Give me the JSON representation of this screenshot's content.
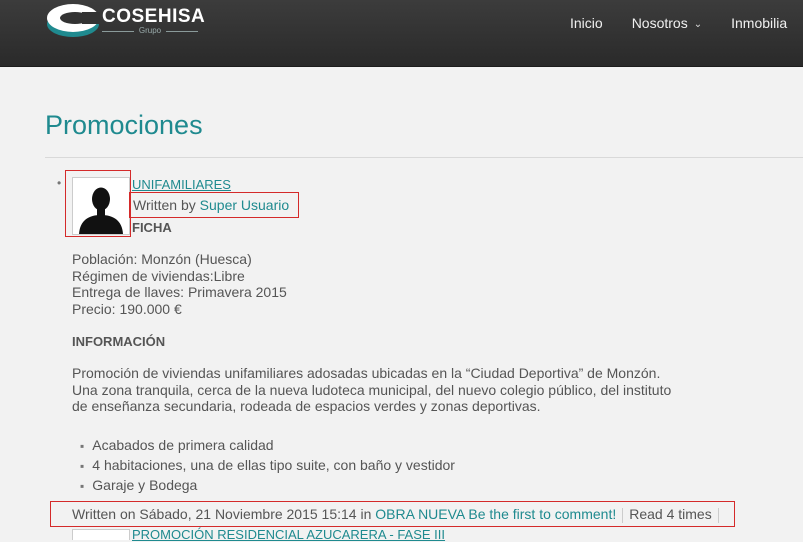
{
  "header": {
    "logo_name": "COSEHISA",
    "logo_sub": "Grupo",
    "nav": [
      {
        "label": "Inicio"
      },
      {
        "label": "Nosotros",
        "has_dropdown": true
      },
      {
        "label": "Inmobilia"
      }
    ]
  },
  "page": {
    "title": "Promociones"
  },
  "post": {
    "title": "UNIFAMILIARES",
    "written_by_label": "Written by",
    "author": "Super Usuario",
    "ficha_heading": "FICHA",
    "details": [
      "Población: Monzón (Huesca)",
      "Régimen de viviendas:Libre",
      "Entrega de llaves: Primavera 2015",
      "Precio: 190.000 €"
    ],
    "info_heading": "INFORMACIÓN",
    "paragraph": [
      "Promoción de viviendas unifamiliares adosadas ubicadas en la “Ciudad Deportiva” de Monzón.",
      "Una zona tranquila, cerca de la nueva ludoteca municipal, del nuevo colegio público, del instituto",
      "de enseñanza secundaria, rodeada de espacios verdes y zonas deportivas."
    ],
    "features": [
      "Acabados de primera calidad",
      "4 habitaciones, una de ellas tipo suite, con baño y vestidor",
      "Garaje y Bodega"
    ],
    "meta": {
      "written_on": "Written on Sábado, 21 Noviembre 2015 15:14 in",
      "category": "OBRA NUEVA",
      "comment_link": "Be the first to comment!",
      "reads": "Read 4 times"
    }
  },
  "next_post": {
    "title": "PROMOCIÓN RESIDENCIAL AZUCARERA - FASE III"
  },
  "colors": {
    "accent": "#1f8a8f",
    "header_bg": "#333333",
    "highlight_box": "#d42a2a"
  }
}
